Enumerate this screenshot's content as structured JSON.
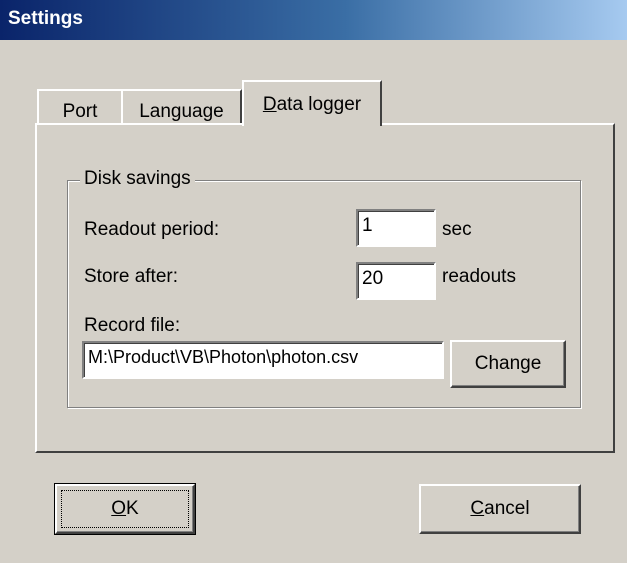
{
  "window": {
    "title": "Settings"
  },
  "tabs": [
    {
      "label": "Port",
      "active": false
    },
    {
      "label": "Language",
      "active": false
    },
    {
      "label_mnemonic": "D",
      "label_rest": "ata logger",
      "active": true
    }
  ],
  "disk_savings": {
    "title": "Disk savings",
    "readout_period": {
      "label": "Readout period:",
      "value": "1",
      "unit": "sec"
    },
    "store_after": {
      "label": "Store after:",
      "value": "20",
      "unit": "readouts"
    },
    "record_file": {
      "label": "Record file:",
      "value": "M:\\Product\\VB\\Photon\\photon.csv"
    },
    "change_button": "Change"
  },
  "buttons": {
    "ok": {
      "mnemonic": "O",
      "rest": "K"
    },
    "cancel": {
      "mnemonic": "C",
      "rest": "ancel"
    }
  }
}
